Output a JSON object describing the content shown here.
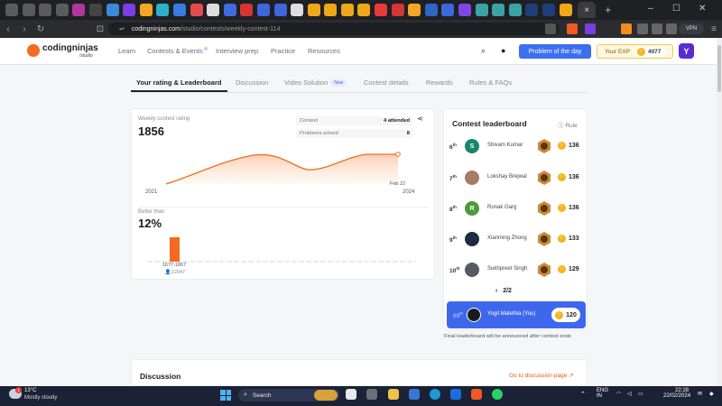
{
  "browser": {
    "url_host": "codingninjas.com",
    "url_path": "/studio/contests/weekly-contest-114",
    "new_tab_symbol": "+",
    "close_tab_symbol": "×",
    "vpn_label": "VPN",
    "nav_icons": [
      "back-icon",
      "forward-icon",
      "reload-icon"
    ]
  },
  "header": {
    "logo_text": "codingninjas",
    "logo_sub": "/studio",
    "nav": [
      "Learn",
      "Contests & Events",
      "Interview prep",
      "Practice",
      "Resources"
    ],
    "problem_of_day": "Problem of the day",
    "exp_label": "Your EXP",
    "exp_value": "4077",
    "avatar_initial": "Y"
  },
  "tabs": [
    {
      "label": "Your rating & Leaderboard",
      "active": true
    },
    {
      "label": "Discussion"
    },
    {
      "label": "Video Solution",
      "badge": "New"
    },
    {
      "label": "Contest details"
    },
    {
      "label": "Rewards"
    },
    {
      "label": "Rules & FAQs"
    }
  ],
  "rating": {
    "label": "Weekly contest rating",
    "value": "1856",
    "stats": [
      {
        "key": "Contest",
        "value": "4 attended"
      },
      {
        "key": "Problems solved",
        "value": "8"
      }
    ],
    "year_start": "2021",
    "year_end": "2024",
    "last_point_label": "Feb 22",
    "better_than_label": "Better than",
    "better_than_value": "12%",
    "range_label": "1677-1867",
    "participants": "22947",
    "accent": "#f26b21"
  },
  "leaderboard": {
    "title": "Contest leaderboard",
    "rule_label": "Rule",
    "rows": [
      {
        "rank": "6",
        "suffix": "th",
        "initial": "S",
        "avatar_color": "#16866e",
        "name": "Shivam Kumar",
        "score": "136"
      },
      {
        "rank": "7",
        "suffix": "th",
        "initial": "",
        "avatar_color": "#a87b66",
        "name": "Lokshay Brejwal",
        "score": "136"
      },
      {
        "rank": "8",
        "suffix": "th",
        "initial": "R",
        "avatar_color": "#4f9a3a",
        "name": "Ronak Garg",
        "score": "136"
      },
      {
        "rank": "9",
        "suffix": "th",
        "initial": "",
        "avatar_color": "#1d2c40",
        "name": "Xianming Zhong",
        "score": "133"
      },
      {
        "rank": "10",
        "suffix": "th",
        "initial": "",
        "avatar_color": "#565a63",
        "name": "Sukhpreet Singh",
        "score": "129"
      }
    ],
    "page": "2/2",
    "you": {
      "rank": "69",
      "suffix": "th",
      "name": "Yogit Malethia (You)",
      "score": "120"
    },
    "note": "Final leaderboard will be announced after contest ends"
  },
  "discussion": {
    "title": "Discussion",
    "link": "Go to discussion page"
  },
  "taskbar": {
    "temperature": "13°C",
    "condition": "Mostly cloudy",
    "notification_count": "1",
    "search": "Search",
    "lang": "ENG",
    "region": "IN",
    "time": "22:28",
    "date": "22/02/2024"
  }
}
